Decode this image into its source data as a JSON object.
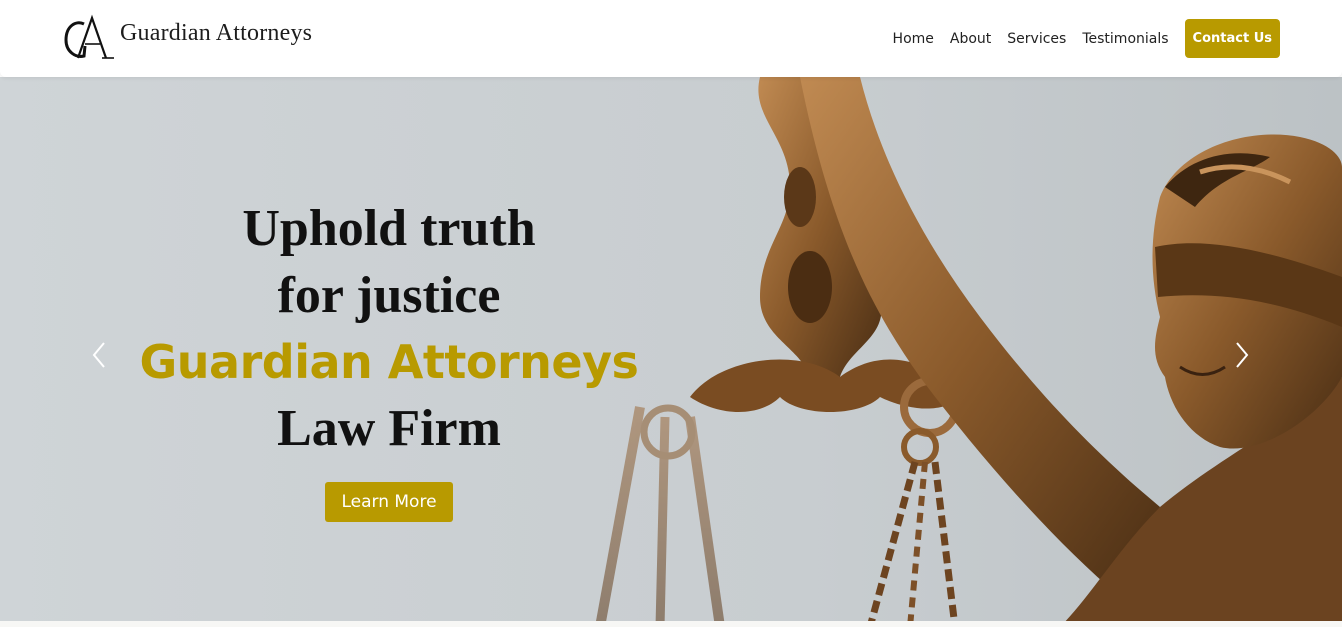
{
  "brand": {
    "monogram": "GA",
    "name": "Guardian Attorneys"
  },
  "nav": {
    "items": [
      {
        "label": "Home"
      },
      {
        "label": "About"
      },
      {
        "label": "Services"
      },
      {
        "label": "Testimonials"
      }
    ],
    "cta_label": "Contact Us"
  },
  "hero": {
    "line1": "Uphold truth",
    "line2": "for justice",
    "brand_line": "Guardian Attorneys",
    "line4": "Law Firm",
    "button_label": "Learn More",
    "prev_icon": "chevron-left-icon",
    "next_icon": "chevron-right-icon"
  },
  "colors": {
    "accent": "#b89a00",
    "hero_background": "#cdd2d5",
    "text_dark": "#111111",
    "bronze": "#8a5a2b"
  }
}
